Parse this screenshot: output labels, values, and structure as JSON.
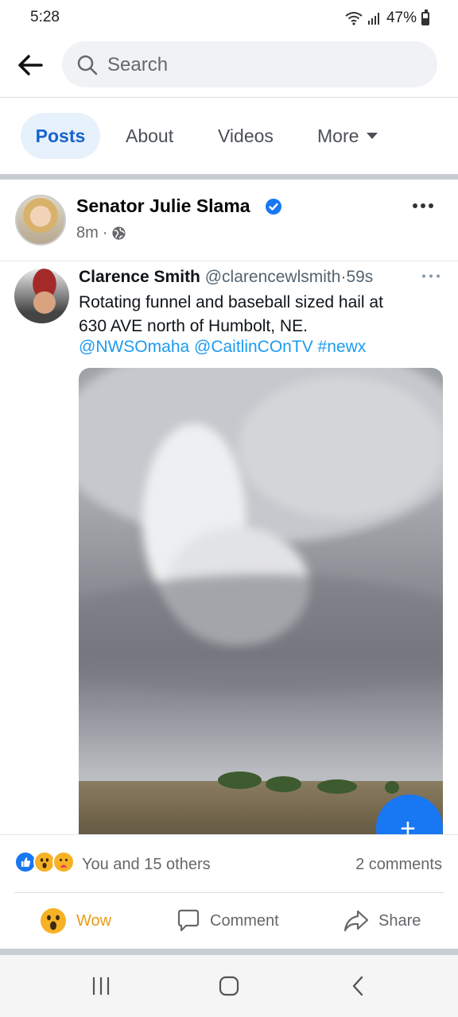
{
  "status": {
    "time": "5:28",
    "battery": "47%"
  },
  "search": {
    "placeholder": "Search"
  },
  "tabs": [
    {
      "label": "Posts",
      "active": true
    },
    {
      "label": "About"
    },
    {
      "label": "Videos"
    },
    {
      "label": "More"
    }
  ],
  "post": {
    "author": "Senator Julie Slama",
    "time": "8m",
    "separator": "·"
  },
  "tweet": {
    "name": "Clarence Smith",
    "handle": "@clarencewlsmith",
    "dot": "·",
    "time": "59s",
    "text_line1": "Rotating funnel and baseball sized hail at",
    "text_line2": "630 AVE north of Humbolt, NE.",
    "links": "@NWSOmaha @CaitlinCOnTV #newx"
  },
  "engagement": {
    "reaction_summary": "You and 15 others",
    "comments": "2 comments"
  },
  "actions": {
    "wow": "Wow",
    "comment": "Comment",
    "share": "Share"
  },
  "colors": {
    "accent": "#1763cf",
    "link": "#1d9bf0",
    "wow": "#e99b15"
  },
  "icons": [
    "back-arrow-icon",
    "search-icon",
    "verified-icon",
    "globe-icon",
    "more-dots-icon",
    "plus-icon",
    "wow-emoji-icon",
    "comment-icon",
    "share-icon",
    "recents-icon",
    "home-icon",
    "back-icon"
  ]
}
